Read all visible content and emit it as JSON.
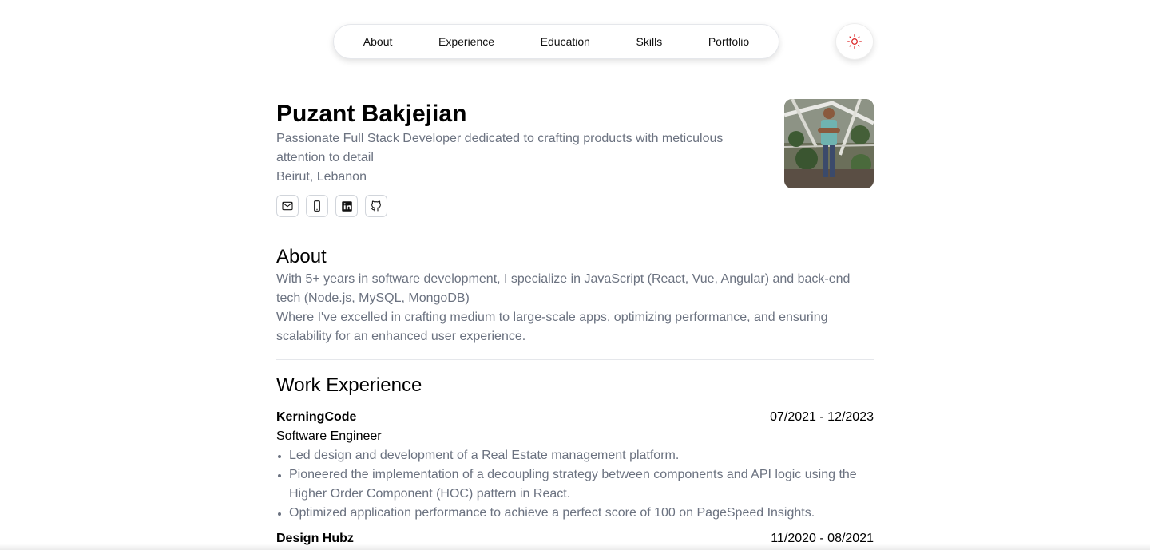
{
  "nav": {
    "items": [
      "About",
      "Experience",
      "Education",
      "Skills",
      "Portfolio"
    ]
  },
  "theme_toggle": {
    "icon": "sun-icon",
    "accent": "#dc2626"
  },
  "profile": {
    "name": "Puzant Bakjejian",
    "tagline": "Passionate Full Stack Developer dedicated to crafting products with meticulous attention to detail",
    "location": "Beirut, Lebanon",
    "socials": [
      "mail-icon",
      "phone-icon",
      "linkedin-icon",
      "github-icon"
    ]
  },
  "about": {
    "title": "About",
    "paragraphs": [
      "With 5+ years in software development, I specialize in JavaScript (React, Vue, Angular) and back-end tech (Node.js, MySQL, MongoDB)",
      "Where I've excelled in crafting medium to large-scale apps, optimizing performance, and ensuring scalability for an enhanced user experience."
    ]
  },
  "work": {
    "title": "Work Experience",
    "jobs": [
      {
        "company": "KerningCode",
        "dates": "07/2021 - 12/2023",
        "role": "Software Engineer",
        "bullets": [
          "Led design and development of a Real Estate management platform.",
          "Pioneered the implementation of a decoupling strategy between components and API logic using the Higher Order Component (HOC) pattern in React.",
          "Optimized application performance to achieve a perfect score of 100 on PageSpeed Insights."
        ]
      },
      {
        "company": "Design Hubz",
        "dates": "11/2020 - 08/2021",
        "role": "",
        "bullets": []
      }
    ]
  },
  "colors": {
    "muted_text": "#6b7280",
    "border": "#e5e7eb"
  }
}
